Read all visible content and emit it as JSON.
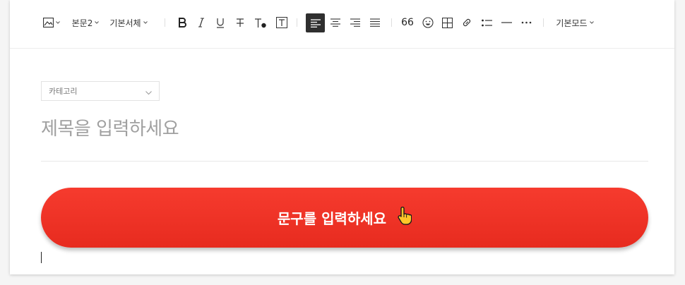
{
  "toolbar": {
    "paragraph_style": "본문2",
    "font_family": "기본서체",
    "mode": "기본모드",
    "quote_glyph": "66"
  },
  "category": {
    "placeholder": "카테고리"
  },
  "title": {
    "placeholder": "제목을 입력하세요"
  },
  "cta": {
    "label": "문구를 입력하세요"
  },
  "colors": {
    "cta": "#f0362a",
    "active_align": "#2f2f2f"
  }
}
